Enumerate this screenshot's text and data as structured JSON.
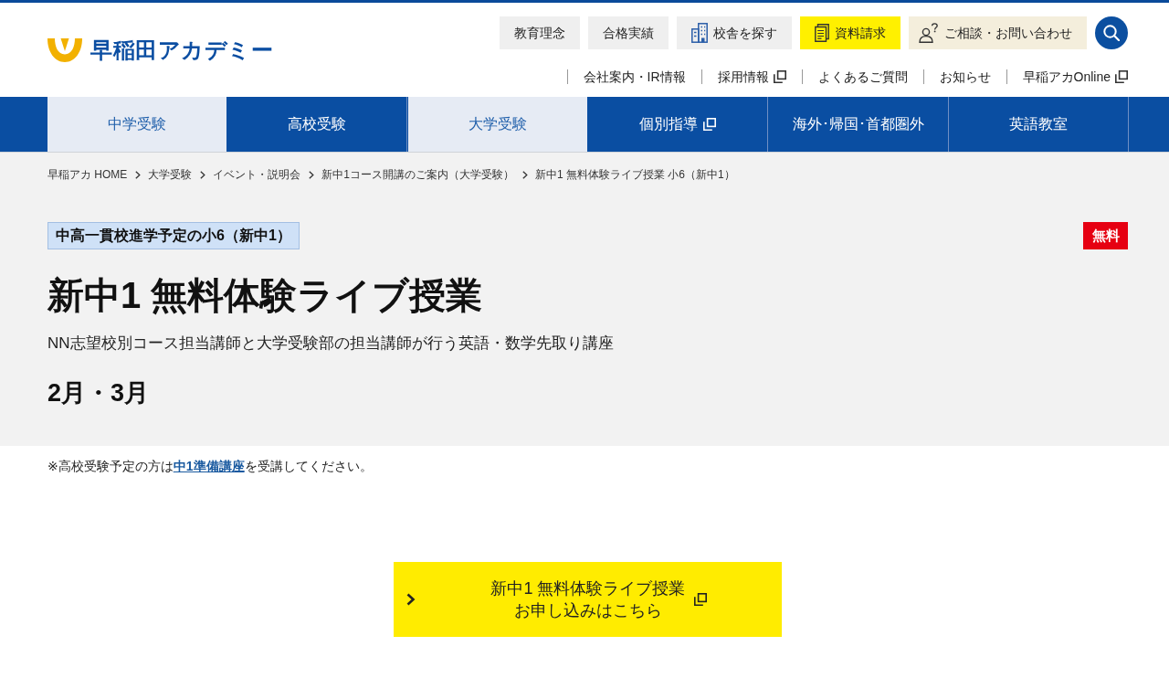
{
  "logo": {
    "text": "早稲田アカデミー"
  },
  "header_buttons": [
    {
      "label": "教育理念",
      "kind": "plain"
    },
    {
      "label": "合格実績",
      "kind": "plain"
    },
    {
      "label": "校舎を探す",
      "kind": "campus"
    },
    {
      "label": "資料請求",
      "kind": "request"
    },
    {
      "label": "ご相談・お問い合わせ",
      "kind": "contact"
    }
  ],
  "utility_links": [
    {
      "label": "会社案内・IR情報",
      "external": false
    },
    {
      "label": "採用情報",
      "external": true
    },
    {
      "label": "よくあるご質問",
      "external": false
    },
    {
      "label": "お知らせ",
      "external": false
    },
    {
      "label": "早稲アカOnline",
      "external": true
    }
  ],
  "main_nav": [
    {
      "label": "中学受験",
      "selected": true,
      "external": false
    },
    {
      "label": "高校受験",
      "selected": false,
      "external": false
    },
    {
      "label": "大学受験",
      "selected": true,
      "external": false
    },
    {
      "label": "個別指導",
      "selected": false,
      "external": true
    },
    {
      "label": "海外･帰国･首都圏外",
      "selected": false,
      "external": false
    },
    {
      "label": "英語教室",
      "selected": false,
      "external": false
    }
  ],
  "breadcrumb": [
    "早稲アカ HOME",
    "大学受験",
    "イベント・説明会",
    "新中1コース開講のご案内（大学受験）",
    "新中1 無料体験ライブ授業 小6（新中1）"
  ],
  "page_header": {
    "category_tag": "中高一貫校進学予定の小6（新中1）",
    "badge": "無料",
    "title": "新中1 無料体験ライブ授業",
    "subtitle": "NN志望校別コース担当講師と大学受験部の担当講師が行う英語・数学先取り講座",
    "period": "2月・3月"
  },
  "note": {
    "text_before": "※高校受験予定の方は",
    "link": "中1準備講座",
    "text_after": "を受講してください。"
  },
  "cta_button": {
    "lines": [
      "新中1 無料体験ライブ授業",
      "お申し込みはこちら"
    ],
    "external": true
  }
}
